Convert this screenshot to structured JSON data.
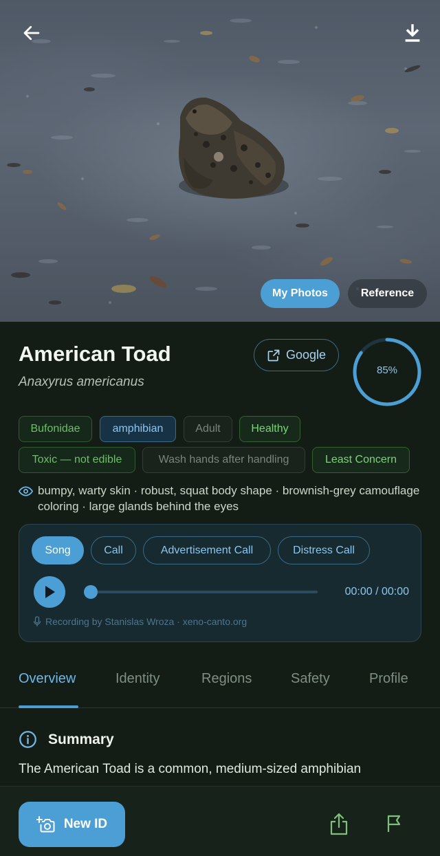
{
  "hero": {
    "photo_subject": "toad-photo",
    "toggle_mine": "My Photos",
    "toggle_reference": "Reference",
    "selected": "My Photos"
  },
  "species": {
    "common_name": "American Toad",
    "scientific_name": "Anaxyrus americanus",
    "google_label": "Google",
    "confidence": 0.85,
    "confidence_label": "85%"
  },
  "chips": {
    "row1": [
      "Bufonidae",
      "amphibian",
      "Adult",
      "Healthy"
    ],
    "row2": [
      "Toxic — not edible",
      "Wash hands after handling",
      "Least Concern"
    ]
  },
  "traits": "bumpy, warty skin · robust, squat body shape · brownish-grey camouflage coloring · large glands behind the eyes",
  "audio": {
    "call_types": [
      "Song",
      "Call",
      "Advertisement Call",
      "Distress Call"
    ],
    "selected": "Song",
    "progress": 0,
    "time": "00:00 / 00:00",
    "credit": "Recording by Stanislas Wroza · xeno-canto.org"
  },
  "tabs": [
    "Overview",
    "Identity",
    "Regions",
    "Safety",
    "Profile"
  ],
  "active_tab": "Overview",
  "summary": {
    "title": "Summary",
    "text": "The American Toad is a common, medium-sized amphibian"
  },
  "bottom": {
    "new_id_label": "New ID"
  },
  "colors": {
    "accent": "#4b9fd4",
    "background": "#141d15",
    "chip_green": "#6fbe6a",
    "chip_blue": "#8cc6ee"
  },
  "icons": {
    "back": "arrow-left-icon",
    "download": "download-icon",
    "external": "external-link-icon",
    "eye": "eye-icon",
    "play": "play-icon",
    "mic": "microphone-icon",
    "info": "info-icon",
    "camera": "camera-plus-icon",
    "share": "share-icon",
    "flag": "flag-icon"
  }
}
